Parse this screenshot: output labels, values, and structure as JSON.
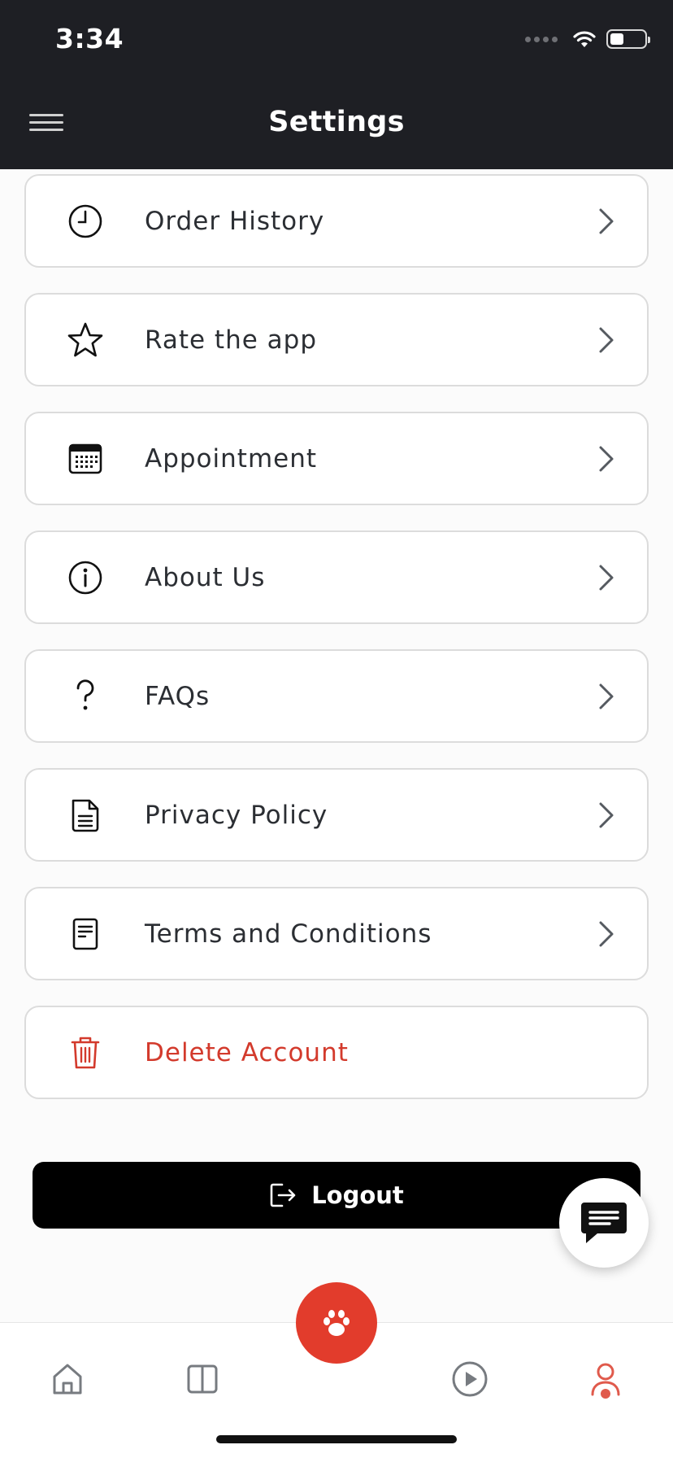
{
  "status_bar": {
    "time": "3:34"
  },
  "header": {
    "title": "Settings"
  },
  "settings": {
    "items": [
      {
        "label": "Order History",
        "icon": "clock-icon"
      },
      {
        "label": "Rate the app",
        "icon": "star-icon"
      },
      {
        "label": "Appointment",
        "icon": "calendar-icon"
      },
      {
        "label": "About Us",
        "icon": "info-icon"
      },
      {
        "label": "FAQs",
        "icon": "question-icon"
      },
      {
        "label": "Privacy Policy",
        "icon": "document-icon"
      },
      {
        "label": "Terms and Conditions",
        "icon": "terms-icon"
      },
      {
        "label": "Delete Account",
        "icon": "trash-icon"
      }
    ]
  },
  "logout": {
    "label": "Logout"
  },
  "bottom_nav": {
    "items": [
      "home-icon",
      "book-icon",
      "paw-icon",
      "play-icon",
      "profile-icon"
    ],
    "active": "profile-icon"
  },
  "colors": {
    "header_bg": "#1e1f24",
    "accent": "#e23c2c",
    "danger": "#d33a2c",
    "text": "#2b2e33"
  }
}
